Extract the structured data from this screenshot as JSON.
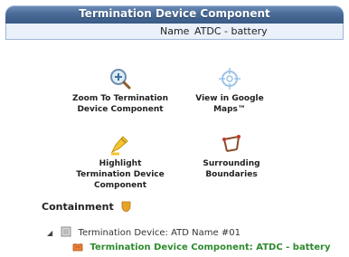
{
  "panel": {
    "title": "Termination Device Component",
    "name_label": "Name",
    "name_value": "ATDC - battery"
  },
  "actions": {
    "zoom": {
      "label": "Zoom To Termination Device Component",
      "icon": "magnifier-zoom-icon"
    },
    "google": {
      "label": "View in Google Maps™",
      "icon": "crosshair-target-icon"
    },
    "highlight": {
      "label": "Highlight Termination Device Component",
      "icon": "highlighter-pen-icon"
    },
    "boundaries": {
      "label": "Surrounding Boundaries",
      "icon": "boundary-frame-icon"
    }
  },
  "containment": {
    "label": "Containment",
    "icon": "shield-icon",
    "tree": {
      "parent": {
        "label": "Termination Device: ATD Name #01",
        "icon": "device-icon",
        "expander": "expand-triangle-icon"
      },
      "child": {
        "label": "Termination Device Component: ATDC - battery",
        "icon": "component-icon"
      }
    }
  },
  "colors": {
    "title_bar": "#4b6c98",
    "name_row_bg": "#eaf1fb",
    "child_text": "#2d8a2d",
    "accent_orange": "#e8a32a"
  }
}
